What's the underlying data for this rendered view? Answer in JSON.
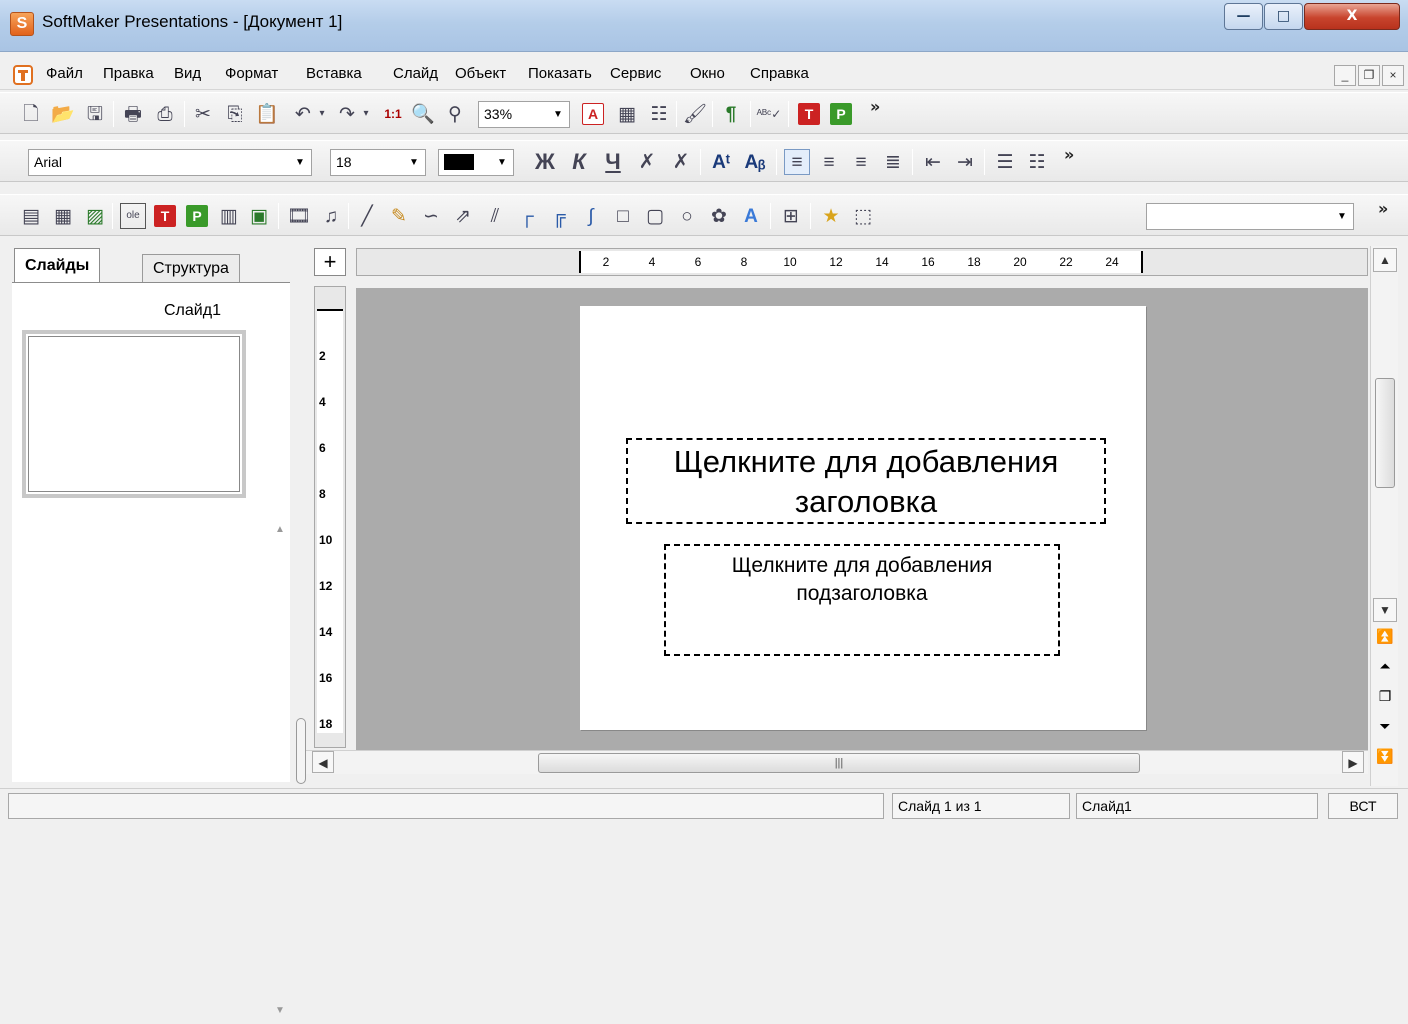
{
  "window": {
    "title": "SoftMaker Presentations - [Документ 1]",
    "controls": {
      "minimize": "—",
      "maximize": "□",
      "close": "X"
    }
  },
  "menu": {
    "items": [
      "Файл",
      "Правка",
      "Вид",
      "Формат",
      "Вставка",
      "Слайд",
      "Объект",
      "Показать",
      "Сервис",
      "Окно",
      "Справка"
    ],
    "mdi": {
      "minimize": "_",
      "restore": "❐",
      "close": "×"
    }
  },
  "toolbar_standard": {
    "zoom_value": "33%",
    "overflow": "»"
  },
  "toolbar_format": {
    "font_name": "Arial",
    "font_size": "18",
    "bold_label": "Ж",
    "italic_label": "К",
    "underline_label": "Ч",
    "overflow": "»"
  },
  "toolbar_objects": {
    "style_combo_value": "",
    "overflow": "»",
    "ole_label": "ole"
  },
  "left_panel": {
    "tabs": [
      "Слайды",
      "Структура"
    ],
    "thumbnail_label": "Слайд1"
  },
  "rulers": {
    "horizontal": [
      "2",
      "4",
      "6",
      "8",
      "10",
      "12",
      "14",
      "16",
      "18",
      "20",
      "22",
      "24"
    ],
    "vertical": [
      "2",
      "4",
      "6",
      "8",
      "10",
      "12",
      "14",
      "16",
      "18"
    ]
  },
  "slide": {
    "title_placeholder": "Щелкните для добавления заголовка",
    "subtitle_placeholder": "Щелкните для добавления подзаголовка"
  },
  "statusbar": {
    "message": "",
    "slide_position": "Слайд 1 из 1",
    "slide_name": "Слайд1",
    "mode": "ВСТ"
  },
  "colors": {
    "accent_red": "#cc2222",
    "accent_green": "#3a9a2a",
    "canvas_gray": "#ababab",
    "title_bar_blue": "#b4cde9"
  }
}
